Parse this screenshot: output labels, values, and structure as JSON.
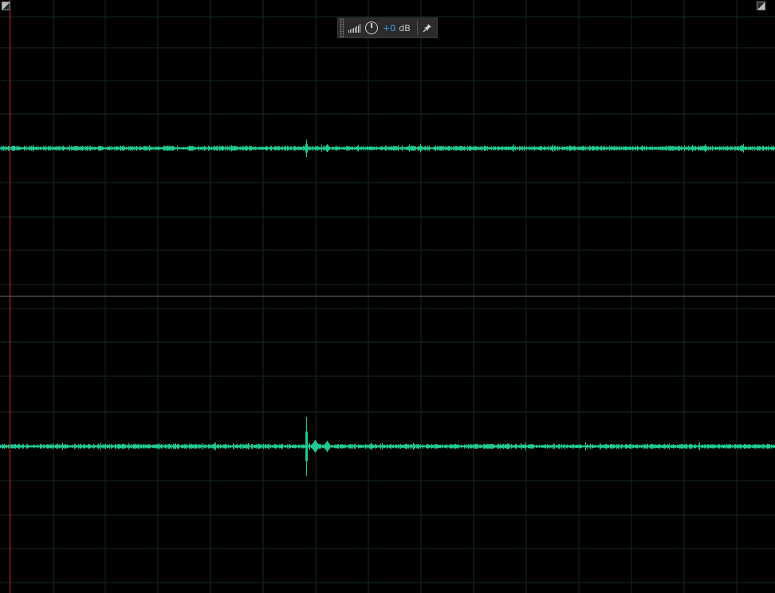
{
  "app": {
    "view": "waveform-editor",
    "channels": 2
  },
  "colors": {
    "waveform": "#20c994",
    "grid": "#142a1c",
    "playhead": "#d42020",
    "background": "#000000",
    "hud_value": "#3d9be9"
  },
  "hud": {
    "volume_value": "+0",
    "volume_unit": "dB",
    "icons": [
      "level-meter-icon",
      "volume-knob-icon",
      "pin-icon"
    ]
  }
}
